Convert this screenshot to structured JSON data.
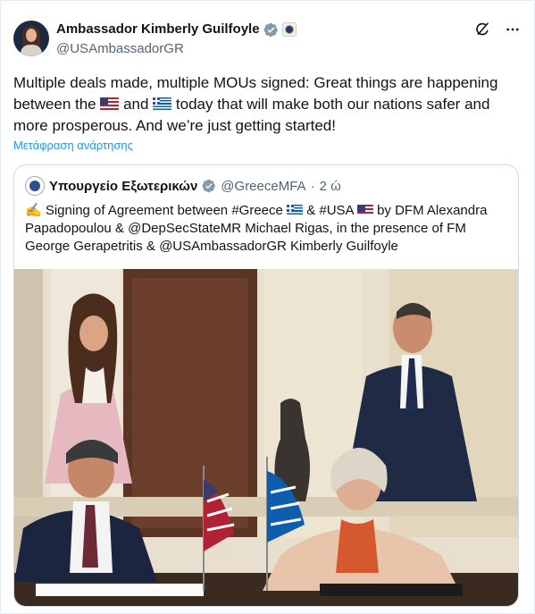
{
  "author": {
    "display_name": "Ambassador Kimberly Guilfoyle",
    "handle": "@USAmbassadorGR"
  },
  "post": {
    "text_part1": "Multiple deals made, multiple MOUs signed: Great things are happening between the ",
    "text_part2": " and ",
    "text_part3": " today that will make both our nations safer and more prosperous. And we’re just getting started!",
    "translate_link": "Μετάφραση ανάρτησης"
  },
  "quoted": {
    "name": "Υπουργείο Εξωτερικών",
    "handle": "@GreeceMFA",
    "separator": "·",
    "time": "2 ώ",
    "text_part1": "✍️ Signing of Agreement between #Greece ",
    "text_part2": " & #USA ",
    "text_part3": " by DFM Alexandra Papadopoulou & @DepSecStateMR Michael Rigas, in the presence of FM George Gerapetritis & @USAmbassadorGR  Kimberly Guilfoyle"
  },
  "icons": {
    "verified": "verified-badge-icon",
    "affiliate": "gov-seal-icon",
    "grok": "grok-icon",
    "more": "more-icon",
    "flag_us": "us-flag-icon",
    "flag_gr": "greek-flag-icon"
  },
  "colors": {
    "link": "#1d9bf0",
    "verified": "#829aab",
    "text": "#0f1419",
    "secondary": "#536471"
  }
}
